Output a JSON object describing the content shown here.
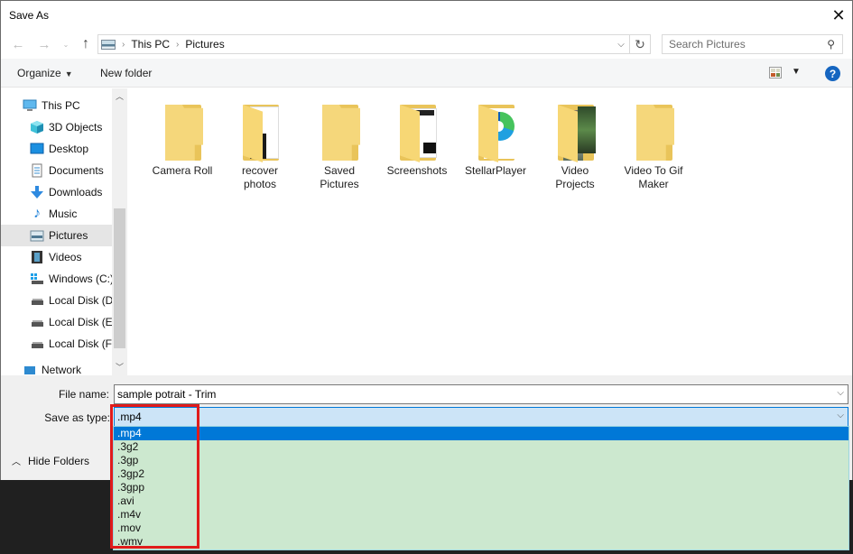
{
  "window": {
    "title": "Save As",
    "close_icon": "close-icon"
  },
  "navigation": {
    "back_icon": "arrow-left-icon",
    "forward_icon": "arrow-right-icon",
    "recent_icon": "chevron-down-icon",
    "up_icon": "arrow-up-icon",
    "breadcrumb": [
      "This PC",
      "Pictures"
    ],
    "refresh_icon": "refresh-icon",
    "search_placeholder": "Search Pictures"
  },
  "toolbar": {
    "organize_label": "Organize",
    "new_folder_label": "New folder",
    "help_label": "?"
  },
  "sidebar": {
    "items": [
      {
        "label": "This PC",
        "icon": "computer-icon",
        "selected": false
      },
      {
        "label": "3D Objects",
        "icon": "cube-icon",
        "selected": false
      },
      {
        "label": "Desktop",
        "icon": "desktop-icon",
        "selected": false
      },
      {
        "label": "Documents",
        "icon": "document-icon",
        "selected": false
      },
      {
        "label": "Downloads",
        "icon": "download-icon",
        "selected": false
      },
      {
        "label": "Music",
        "icon": "music-icon",
        "selected": false
      },
      {
        "label": "Pictures",
        "icon": "pictures-icon",
        "selected": true
      },
      {
        "label": "Videos",
        "icon": "video-icon",
        "selected": false
      },
      {
        "label": "Windows (C:)",
        "icon": "drive-windows-icon",
        "selected": false
      },
      {
        "label": "Local Disk (D:)",
        "icon": "drive-icon",
        "selected": false
      },
      {
        "label": "Local Disk (E:)",
        "icon": "drive-icon",
        "selected": false
      },
      {
        "label": "Local Disk (F:)",
        "icon": "drive-icon",
        "selected": false
      }
    ],
    "network_label": "Network"
  },
  "folders": [
    {
      "name": "Camera Roll",
      "line1": "Camera Roll",
      "line2": ""
    },
    {
      "name": "recover photos",
      "line1": "recover",
      "line2": "photos"
    },
    {
      "name": "Saved Pictures",
      "line1": "Saved",
      "line2": "Pictures"
    },
    {
      "name": "Screenshots",
      "line1": "Screenshots",
      "line2": ""
    },
    {
      "name": "StellarPlayer",
      "line1": "StellarPlayer",
      "line2": ""
    },
    {
      "name": "Video Projects",
      "line1": "Video",
      "line2": "Projects"
    },
    {
      "name": "Video To Gif Maker",
      "line1": "Video To Gif",
      "line2": "Maker"
    }
  ],
  "form": {
    "file_name_label": "File name:",
    "file_name_value": "sample potrait - Trim",
    "save_as_type_label": "Save as type:",
    "save_as_type_value": ".mp4",
    "hide_folders_label": "Hide Folders"
  },
  "dropdown": {
    "options": [
      ".mp4",
      ".3g2",
      ".3gp",
      ".3gp2",
      ".3gpp",
      ".avi",
      ".m4v",
      ".mov",
      ".wmv"
    ],
    "selected_index": 0
  },
  "colors": {
    "selection_blue": "#0078d7",
    "dropdown_bg": "#cce8cf",
    "highlight_red": "#e01b1b",
    "help_blue": "#1565c0"
  }
}
